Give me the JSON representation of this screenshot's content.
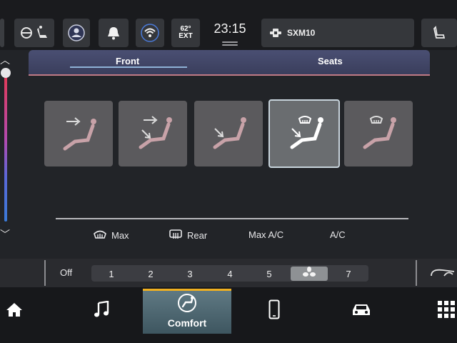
{
  "status_bar": {
    "temperature": "62°",
    "temperature_unit": "EXT",
    "clock": "23:15",
    "radio_station": "SXM10",
    "icons": [
      "heated-seat-steering-icon",
      "driver-profile-icon",
      "bell-icon",
      "wifi-icon",
      "satellite-radio-icon",
      "seat-icon"
    ]
  },
  "tabs": [
    {
      "label": "Front",
      "selected": true
    },
    {
      "label": "Seats",
      "selected": false
    }
  ],
  "airflow_modes": [
    {
      "icon": "airflow-face-icon",
      "selected": false
    },
    {
      "icon": "airflow-face-feet-icon",
      "selected": false
    },
    {
      "icon": "airflow-feet-icon",
      "selected": false
    },
    {
      "icon": "airflow-feet-defrost-icon",
      "selected": true
    },
    {
      "icon": "airflow-defrost-icon",
      "selected": false
    }
  ],
  "options": {
    "max_defrost": "Max",
    "rear_defrost": "Rear",
    "max_ac": "Max A/C",
    "ac": "A/C"
  },
  "fan": {
    "off_label": "Off",
    "speeds": [
      "1",
      "2",
      "3",
      "4",
      "5",
      "6",
      "7"
    ],
    "selected_speed": "6",
    "selected_icon": "fan-icon"
  },
  "dock": {
    "items": [
      {
        "icon": "home-icon",
        "label": ""
      },
      {
        "icon": "music-icon",
        "label": ""
      },
      {
        "icon": "comfort-icon",
        "label": "Comfort",
        "selected": true
      },
      {
        "icon": "phone-icon",
        "label": ""
      },
      {
        "icon": "car-icon",
        "label": ""
      },
      {
        "icon": "apps-grid-icon",
        "label": ""
      }
    ]
  },
  "colors": {
    "accent_active": "#f0b020",
    "tab_header": "#4a4f73",
    "tab_underline": "#8fb2d6"
  }
}
